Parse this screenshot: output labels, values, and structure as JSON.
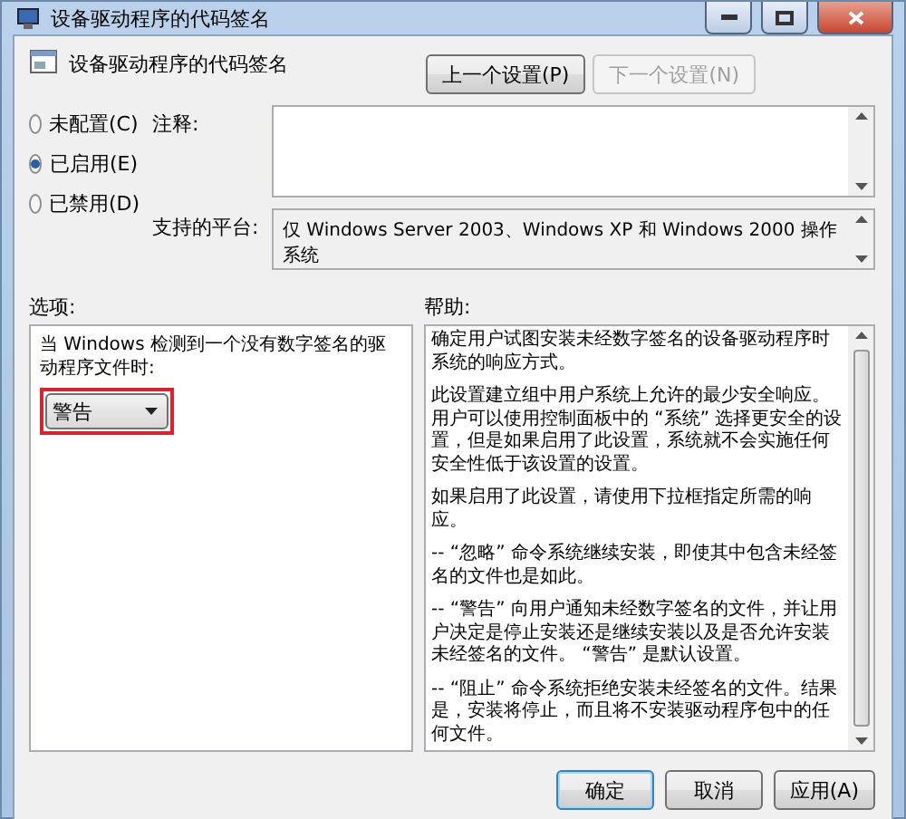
{
  "window": {
    "title": "设备驱动程序的代码签名"
  },
  "header": {
    "title": "设备驱动程序的代码签名",
    "nav_buttons": [
      {
        "label": "上一个设置(P)",
        "disabled": false
      },
      {
        "label": "下一个设置(N)",
        "disabled": true
      }
    ]
  },
  "state_options": [
    {
      "label": "未配置(C)",
      "selected": false
    },
    {
      "label": "已启用(E)",
      "selected": true
    },
    {
      "label": "已禁用(D)",
      "selected": false
    }
  ],
  "comment": {
    "label": "注释:"
  },
  "platform": {
    "label": "支持的平台:",
    "value": "仅 Windows Server 2003、Windows XP 和 Windows 2000 操作系统"
  },
  "options": {
    "label": "选项:",
    "prompt": "当 Windows 检测到一个没有数字签名的驱动程序文件时:",
    "dropdown": {
      "value": "警告",
      "highlighted": true
    }
  },
  "help": {
    "label": "帮助:",
    "paragraphs": [
      "确定用户试图安装未经数字签名的设备驱动程序时系统的响应方式。",
      "此设置建立组中用户系统上允许的最少安全响应。用户可以使用控制面板中的 “系统” 选择更安全的设置，但是如果启用了此设置，系统就不会实施任何安全性低于该设置的设置。",
      "如果启用了此设置，请使用下拉框指定所需的响应。",
      "-- “忽略” 命令系统继续安装，即使其中包含未经签名的文件也是如此。",
      "-- “警告” 向用户通知未经数字签名的文件，并让用户决定是停止安装还是继续安装以及是否允许安装未经签名的文件。 “警告” 是默认设置。",
      "-- “阻止” 命令系统拒绝安装未经签名的文件。结果是，安装将停止，而且将不安装驱动程序包中的任何文件。"
    ]
  },
  "footer_buttons": [
    {
      "label": "确定",
      "kind": "default"
    },
    {
      "label": "取消",
      "kind": "normal"
    },
    {
      "label": "应用(A)",
      "kind": "normal"
    }
  ]
}
